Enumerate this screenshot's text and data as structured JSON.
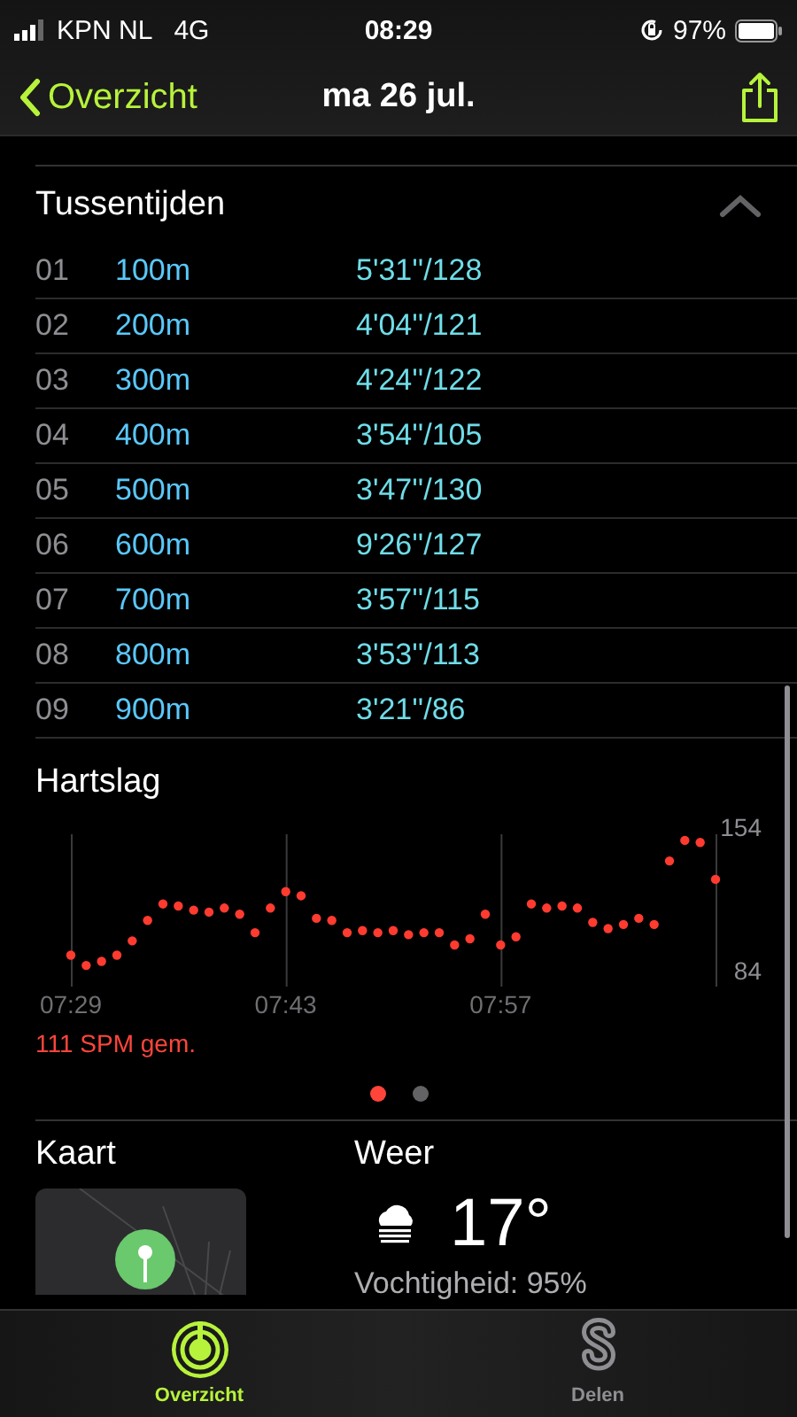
{
  "status_bar": {
    "carrier": "KPN NL",
    "network": "4G",
    "time": "08:29",
    "battery": "97%"
  },
  "nav": {
    "back": "Overzicht",
    "title": "ma 26 jul."
  },
  "splits": {
    "title": "Tussentijden",
    "expanded": true,
    "rows": [
      {
        "index": "01",
        "distance": "100m",
        "pace": "5'31''/128"
      },
      {
        "index": "02",
        "distance": "200m",
        "pace": "4'04''/121"
      },
      {
        "index": "03",
        "distance": "300m",
        "pace": "4'24''/122"
      },
      {
        "index": "04",
        "distance": "400m",
        "pace": "3'54''/105"
      },
      {
        "index": "05",
        "distance": "500m",
        "pace": "3'47''/130"
      },
      {
        "index": "06",
        "distance": "600m",
        "pace": "9'26''/127"
      },
      {
        "index": "07",
        "distance": "700m",
        "pace": "3'57''/115"
      },
      {
        "index": "08",
        "distance": "800m",
        "pace": "3'53''/113"
      },
      {
        "index": "09",
        "distance": "900m",
        "pace": "3'21''/86"
      }
    ]
  },
  "heart_rate": {
    "title": "Hartslag",
    "average": "111 SPM gem.",
    "chart_data": {
      "type": "scatter",
      "categories": [
        "07:29",
        null,
        null,
        null,
        null,
        null,
        null,
        null,
        null,
        null,
        null,
        null,
        null,
        null,
        "07:43",
        null,
        null,
        null,
        null,
        null,
        null,
        null,
        null,
        null,
        null,
        null,
        null,
        null,
        "07:57",
        null,
        null,
        null,
        null,
        null,
        null,
        null,
        null,
        null,
        null,
        null,
        null,
        null,
        null
      ],
      "series": [
        {
          "color": "#ff3b30",
          "values": [
            95,
            90,
            92,
            95,
            102,
            112,
            120,
            119,
            117,
            116,
            118,
            115,
            106,
            118,
            126,
            124,
            113,
            112,
            106,
            107,
            106,
            107,
            105,
            106,
            106,
            100,
            103,
            115,
            100,
            104,
            120,
            118,
            119,
            118,
            111,
            108,
            110,
            113,
            110,
            141,
            151,
            150,
            132
          ]
        }
      ],
      "ylim": [
        84,
        154
      ],
      "yticks": [
        84,
        154
      ],
      "grid": true
    },
    "pages": [
      {
        "selected": true
      },
      {
        "selected": false
      }
    ]
  },
  "map": {
    "title": "Kaart"
  },
  "weather": {
    "title": "Weer",
    "temperature": "17°",
    "humidity": "Vochtigheid: 95%"
  },
  "tab_bar": [
    {
      "label": "Overzicht",
      "selected": true
    },
    {
      "label": "Delen",
      "selected": false
    }
  ]
}
